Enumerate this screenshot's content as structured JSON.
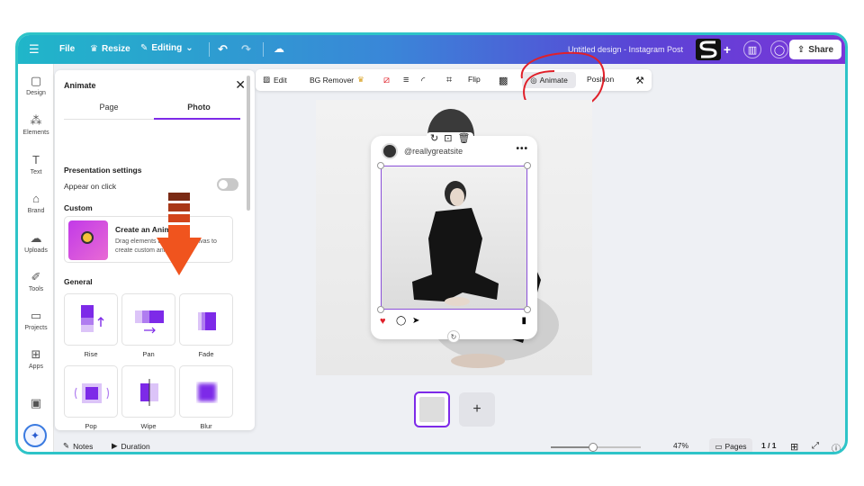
{
  "topbar": {
    "file": "File",
    "resize": "Resize",
    "editing": "Editing",
    "title": "Untitled design - Instagram Post",
    "share": "Share"
  },
  "rail": [
    {
      "label": "Design",
      "icon": "design-icon"
    },
    {
      "label": "Elements",
      "icon": "elements-icon"
    },
    {
      "label": "Text",
      "icon": "text-icon"
    },
    {
      "label": "Brand",
      "icon": "brand-icon"
    },
    {
      "label": "Uploads",
      "icon": "uploads-icon"
    },
    {
      "label": "Tools",
      "icon": "tools-icon"
    },
    {
      "label": "Projects",
      "icon": "projects-icon"
    },
    {
      "label": "Apps",
      "icon": "apps-icon"
    }
  ],
  "panel": {
    "title": "Animate",
    "tabs": [
      "Page",
      "Photo"
    ],
    "active_tab": "Photo",
    "presentation_settings": "Presentation settings",
    "appear_on_click": "Appear on click",
    "custom": "Custom",
    "create_animation_title": "Create an Animation",
    "create_animation_desc": "Drag elements around the canvas to create custom animations.",
    "general": "General",
    "animations": [
      "Rise",
      "Pan",
      "Fade",
      "Pop",
      "Wipe",
      "Blur"
    ]
  },
  "context_toolbar": {
    "edit": "Edit",
    "bg_remover": "BG Remover",
    "flip": "Flip",
    "animate": "Animate",
    "position": "Position"
  },
  "card": {
    "handle": "@reallygreatsite"
  },
  "bottombar": {
    "notes": "Notes",
    "duration": "Duration",
    "zoom": "47%",
    "zoom_level": 0.47,
    "pages": "Pages",
    "page_count": "1 / 1"
  },
  "colors": {
    "accent": "#7d2ae8",
    "frame_border": "#2ec4c8",
    "annotation_red": "#e0202a",
    "arrow_orange": "#f0541e"
  }
}
